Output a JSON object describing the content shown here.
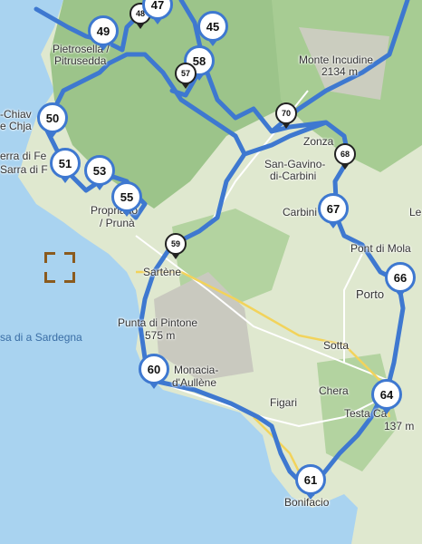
{
  "colors": {
    "sea": "#a9d3f0",
    "land": "#dfe8cf",
    "forest": "#9cc48a",
    "route": "#3e78d0",
    "road": "#ffffff",
    "mountain": "#c9c9bf"
  },
  "places": [
    {
      "text": "Pietrosella /",
      "cls": ""
    },
    {
      "text": "Pitrusedda",
      "cls": ""
    },
    {
      "text": "Monte Incudine",
      "cls": ""
    },
    {
      "text": "2134 m",
      "cls": ""
    },
    {
      "text": "-Chiav",
      "cls": ""
    },
    {
      "text": "e Chja",
      "cls": ""
    },
    {
      "text": "erra di Fe",
      "cls": ""
    },
    {
      "text": "Sarra di F",
      "cls": ""
    },
    {
      "text": "Zonza",
      "cls": ""
    },
    {
      "text": "San-Gavino-",
      "cls": ""
    },
    {
      "text": "di-Carbini",
      "cls": ""
    },
    {
      "text": "Carbini",
      "cls": ""
    },
    {
      "text": "Propriano",
      "cls": ""
    },
    {
      "text": "/ Prunà",
      "cls": ""
    },
    {
      "text": "Sartène",
      "cls": ""
    },
    {
      "text": "Porto",
      "cls": ""
    },
    {
      "text": "Punta di Pintone",
      "cls": ""
    },
    {
      "text": "575 m",
      "cls": ""
    },
    {
      "text": "sa di a Sardegna",
      "cls": "sea"
    },
    {
      "text": "Sotta",
      "cls": ""
    },
    {
      "text": "Monacia-",
      "cls": ""
    },
    {
      "text": "d'Aullène",
      "cls": ""
    },
    {
      "text": "Chera",
      "cls": ""
    },
    {
      "text": "Figari",
      "cls": ""
    },
    {
      "text": "Testa Ca",
      "cls": ""
    },
    {
      "text": "137 m",
      "cls": ""
    },
    {
      "text": "Bonifacio",
      "cls": ""
    },
    {
      "text": "Pont di Mola",
      "cls": ""
    },
    {
      "text": "Le",
      "cls": ""
    }
  ],
  "waypoints": [
    {
      "num": "49",
      "size": "lg"
    },
    {
      "num": "48",
      "size": "sm"
    },
    {
      "num": "47",
      "size": "lg"
    },
    {
      "num": "45",
      "size": "lg"
    },
    {
      "num": "58",
      "size": "lg"
    },
    {
      "num": "57",
      "size": "sm"
    },
    {
      "num": "50",
      "size": "lg"
    },
    {
      "num": "51",
      "size": "lg"
    },
    {
      "num": "53",
      "size": "lg"
    },
    {
      "num": "55",
      "size": "lg"
    },
    {
      "num": "59",
      "size": "sm"
    },
    {
      "num": "70",
      "size": "sm"
    },
    {
      "num": "68",
      "size": "sm"
    },
    {
      "num": "67",
      "size": "lg"
    },
    {
      "num": "66",
      "size": "lg"
    },
    {
      "num": "60",
      "size": "lg"
    },
    {
      "num": "64",
      "size": "lg"
    },
    {
      "num": "61",
      "size": "lg"
    }
  ]
}
